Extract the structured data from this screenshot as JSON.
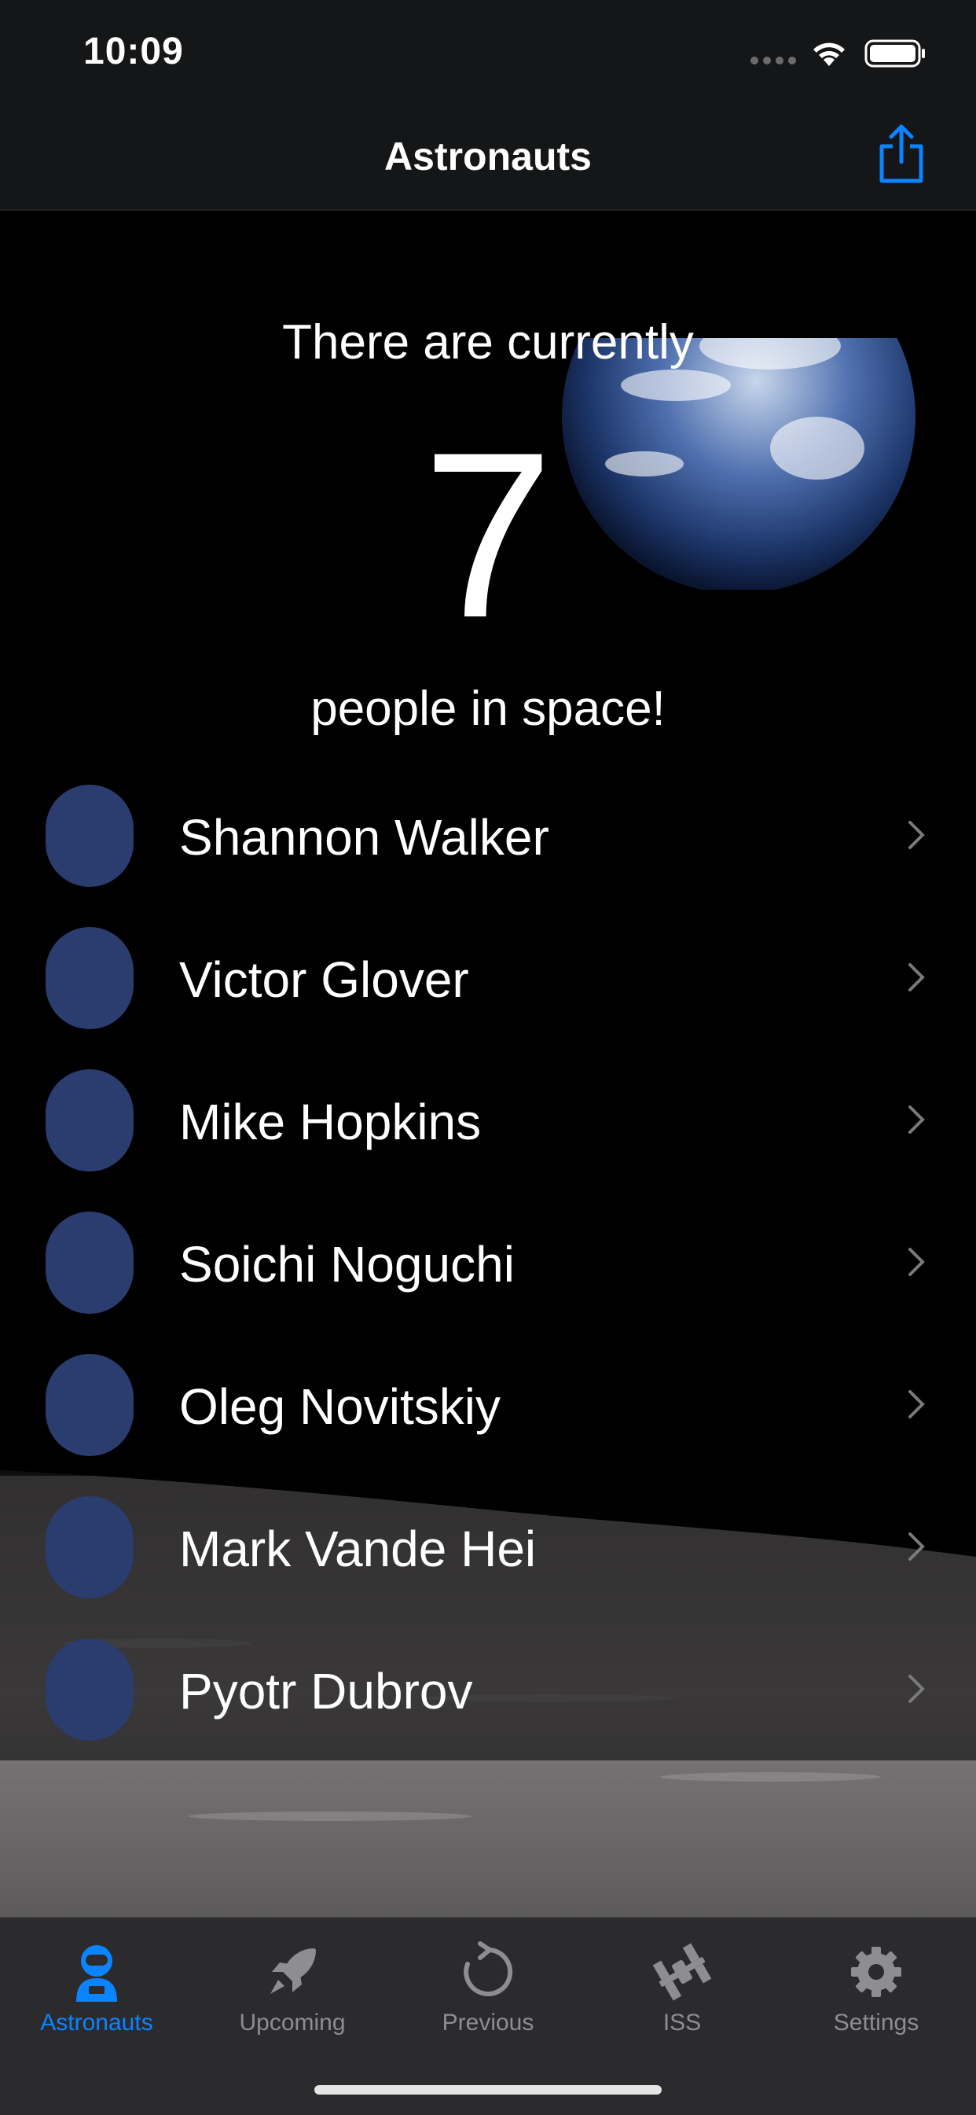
{
  "status_bar": {
    "time": "10:09"
  },
  "nav": {
    "title": "Astronauts"
  },
  "hero": {
    "line1": "There are currently",
    "count": "7",
    "line2": "people in space!"
  },
  "astronauts": [
    {
      "name": "Shannon Walker"
    },
    {
      "name": "Victor Glover"
    },
    {
      "name": "Mike Hopkins"
    },
    {
      "name": "Soichi Noguchi"
    },
    {
      "name": "Oleg Novitskiy"
    },
    {
      "name": "Mark Vande Hei"
    },
    {
      "name": "Pyotr Dubrov"
    }
  ],
  "tabs": [
    {
      "label": "Astronauts",
      "icon": "astronaut-icon",
      "active": true
    },
    {
      "label": "Upcoming",
      "icon": "rocket-icon",
      "active": false
    },
    {
      "label": "Previous",
      "icon": "refresh-icon",
      "active": false
    },
    {
      "label": "ISS",
      "icon": "iss-icon",
      "active": false
    },
    {
      "label": "Settings",
      "icon": "gear-icon",
      "active": false
    }
  ],
  "colors": {
    "accent": "#0a84ff",
    "bar": "#151617",
    "tabbar": "#2b2b2d",
    "inactive": "#8d8d92"
  }
}
